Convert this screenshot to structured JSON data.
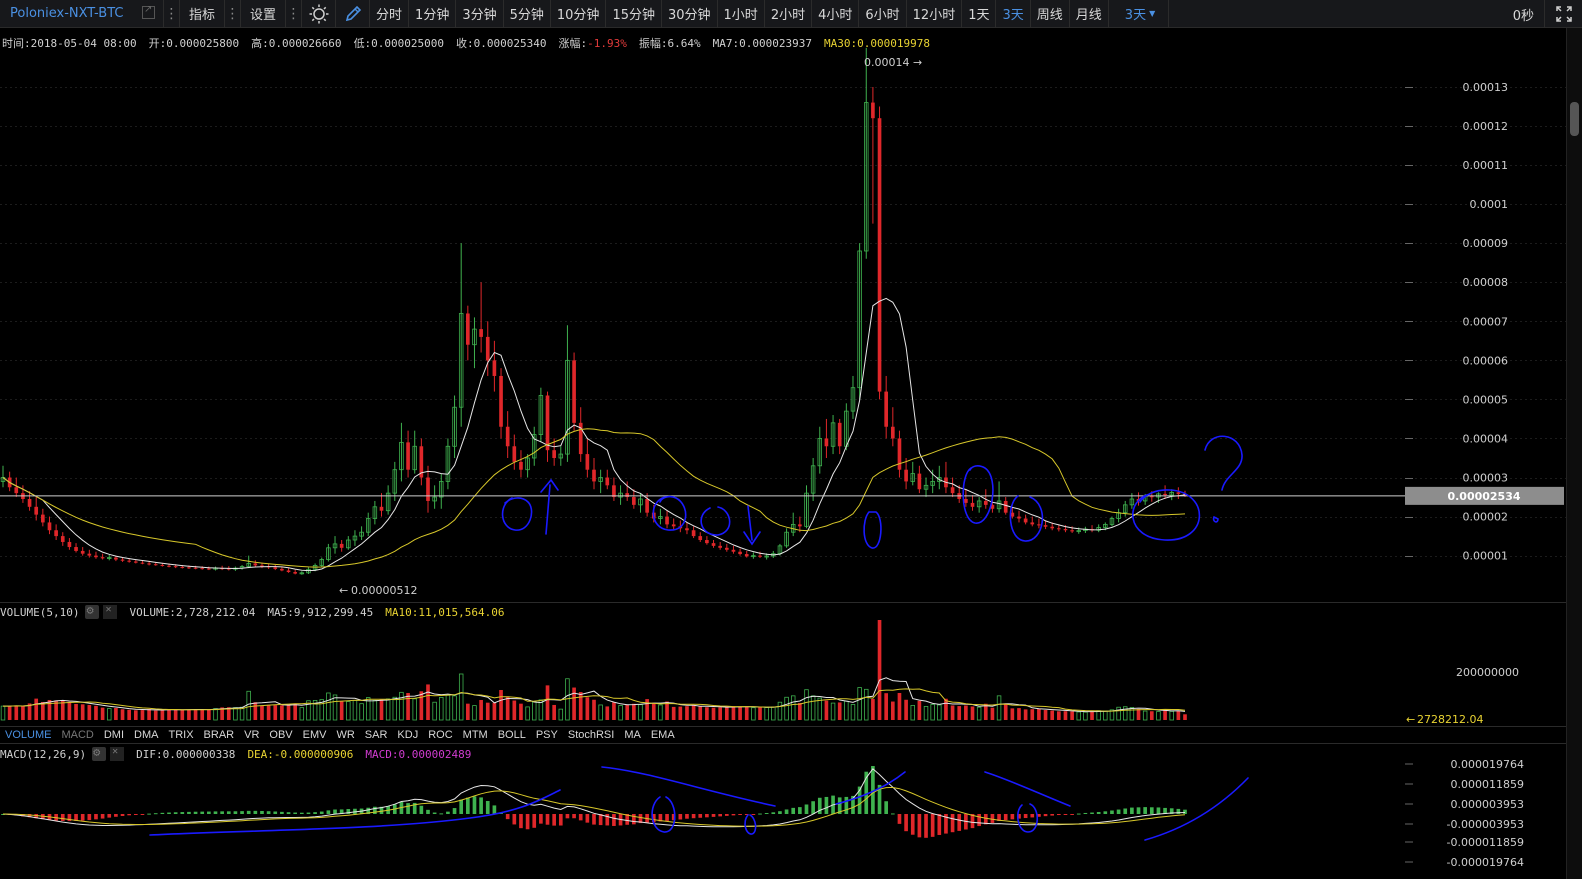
{
  "toolbar": {
    "symbol": "Poloniex-NXT-BTC",
    "indicator_label": "指标",
    "settings_label": "设置",
    "periods": [
      "分时",
      "1分钟",
      "3分钟",
      "5分钟",
      "10分钟",
      "15分钟",
      "30分钟",
      "1小时",
      "2小时",
      "4小时",
      "6小时",
      "12小时",
      "1天",
      "3天",
      "周线",
      "月线"
    ],
    "active_period": "3天",
    "selected_period": "3天",
    "countdown": "0秒"
  },
  "ohlc_info": {
    "time": "时间:2018-05-04 08:00",
    "open": "开:0.000025800",
    "high": "高:0.000026660",
    "low": "低:0.000025000",
    "close": "收:0.000025340",
    "change_label": "涨幅:",
    "change_value": "-1.93%",
    "amplitude": "振幅:6.64%",
    "ma7": "MA7:0.000023937",
    "ma30": "MA30:0.000019978"
  },
  "volume_info": {
    "title": "VOLUME(5,10)",
    "volume": "VOLUME:2,728,212.04",
    "ma5": "MA5:9,912,299.45",
    "ma10": "MA10:11,015,564.06"
  },
  "indicator_tabs": [
    "VOLUME",
    "MACD",
    "DMI",
    "DMA",
    "TRIX",
    "BRAR",
    "VR",
    "OBV",
    "EMV",
    "WR",
    "SAR",
    "KDJ",
    "ROC",
    "MTM",
    "BOLL",
    "PSY",
    "StochRSI",
    "MA",
    "EMA"
  ],
  "active_tab": "VOLUME",
  "dimmed_tab": "MACD",
  "macd_info": {
    "title": "MACD(12,26,9)",
    "dif": "DIF:0.000000338",
    "dea": "DEA:-0.000000906",
    "macd": "MACD:0.000002489"
  },
  "price_axis": {
    "ticks": [
      "0.00013",
      "0.00012",
      "0.00011",
      "0.0001",
      "0.00009",
      "0.00008",
      "0.00007",
      "0.00006",
      "0.00005",
      "0.00004",
      "0.00003",
      "0.00002",
      "0.00001"
    ],
    "current_price_label": "0.00002534",
    "max_marker": "0.00014",
    "min_marker": "0.00000512"
  },
  "volume_axis": {
    "ticks": [
      "200000000"
    ],
    "current_label": "2728212.04"
  },
  "macd_axis": {
    "ticks": [
      "0.000019764",
      "0.000011859",
      "0.000003953",
      "-0.000003953",
      "-0.000011859",
      "-0.000019764"
    ]
  },
  "colors": {
    "up": "#3fb24f",
    "down": "#e0272a",
    "ma7": "#e6e6e6",
    "ma30": "#d7c72a",
    "accent": "#4a90e2",
    "annotation": "#1a1aff"
  },
  "chart_data": {
    "type": "candlestick",
    "title": "Poloniex-NXT-BTC",
    "period": "3天",
    "price_range": [
      1.2e-06,
      0.0001369
    ],
    "series": [
      {
        "name": "MA7"
      },
      {
        "name": "MA30"
      }
    ],
    "candles": [
      [
        2.9e-05,
        3.3e-05,
        2.75e-05,
        3e-05
      ],
      [
        3e-05,
        3.15e-05,
        2.65e-05,
        2.75e-05
      ],
      [
        2.75e-05,
        3e-05,
        2.5e-05,
        2.6e-05
      ],
      [
        2.6e-05,
        2.8e-05,
        2.35e-05,
        2.45e-05
      ],
      [
        2.45e-05,
        2.65e-05,
        2.15e-05,
        2.25e-05
      ],
      [
        2.25e-05,
        2.5e-05,
        1.9e-05,
        2.05e-05
      ],
      [
        2.05e-05,
        2.2e-05,
        1.75e-05,
        1.85e-05
      ],
      [
        1.85e-05,
        2e-05,
        1.55e-05,
        1.65e-05
      ],
      [
        1.65e-05,
        1.8e-05,
        1.4e-05,
        1.5e-05
      ],
      [
        1.5e-05,
        1.6e-05,
        1.25e-05,
        1.35e-05
      ],
      [
        1.35e-05,
        1.45e-05,
        1.15e-05,
        1.22e-05
      ],
      [
        1.22e-05,
        1.32e-05,
        1.08e-05,
        1.12e-05
      ],
      [
        1.12e-05,
        1.22e-05,
        1e-05,
        1.05e-05
      ],
      [
        1.05e-05,
        1.15e-05,
        9.5e-06,
        1e-05
      ],
      [
        1e-05,
        1.1e-05,
        9.2e-06,
        9.6e-06
      ],
      [
        9.6e-06,
        1.05e-05,
        9e-06,
        9.3e-06
      ],
      [
        9.3e-06,
        1.02e-05,
        8.8e-06,
        9.5e-06
      ],
      [
        9.5e-06,
        1e-05,
        8.6e-06,
        9e-06
      ],
      [
        9e-06,
        9.6e-06,
        8.4e-06,
        8.7e-06
      ],
      [
        8.7e-06,
        9.3e-06,
        8.2e-06,
        8.5e-06
      ],
      [
        8.5e-06,
        9e-06,
        8e-06,
        8.2e-06
      ],
      [
        8.2e-06,
        8.8e-06,
        7.8e-06,
        8e-06
      ],
      [
        8e-06,
        8.6e-06,
        7.5e-06,
        7.8e-06
      ],
      [
        7.8e-06,
        8.3e-06,
        7.4e-06,
        7.6e-06
      ],
      [
        7.6e-06,
        8.1e-06,
        7.2e-06,
        7.4e-06
      ],
      [
        7.4e-06,
        8e-06,
        7e-06,
        7.3e-06
      ],
      [
        7.3e-06,
        7.8e-06,
        6.8e-06,
        7.1e-06
      ],
      [
        7.1e-06,
        7.6e-06,
        6.7e-06,
        7e-06
      ],
      [
        7e-06,
        7.5e-06,
        6.6e-06,
        6.9e-06
      ],
      [
        6.9e-06,
        7.4e-06,
        6.5e-06,
        6.8e-06
      ],
      [
        6.8e-06,
        7.3e-06,
        6.4e-06,
        6.7e-06
      ],
      [
        6.7e-06,
        7.2e-06,
        6.3e-06,
        6.6e-06
      ],
      [
        6.6e-06,
        7.2e-06,
        6.2e-06,
        6.8e-06
      ],
      [
        6.8e-06,
        7.4e-06,
        6.3e-06,
        6.7e-06
      ],
      [
        6.7e-06,
        7.3e-06,
        6.2e-06,
        6.6e-06
      ],
      [
        6.6e-06,
        7.2e-06,
        6.1e-06,
        6.8e-06
      ],
      [
        6.8e-06,
        7.6e-06,
        6.4e-06,
        7.2e-06
      ],
      [
        7.2e-06,
        1e-05,
        6.8e-06,
        8e-06
      ],
      [
        8e-06,
        8.8e-06,
        7e-06,
        7.5e-06
      ],
      [
        7.5e-06,
        8.2e-06,
        6.8e-06,
        7.3e-06
      ],
      [
        7.3e-06,
        8e-06,
        6.6e-06,
        7e-06
      ],
      [
        7e-06,
        7.6e-06,
        6.3e-06,
        6.6e-06
      ],
      [
        6.6e-06,
        7.2e-06,
        6e-06,
        6.2e-06
      ],
      [
        6.2e-06,
        6.8e-06,
        5.6e-06,
        5.8e-06
      ],
      [
        5.8e-06,
        6.4e-06,
        5.2e-06,
        5.4e-06
      ],
      [
        5.4e-06,
        6e-06,
        5.1e-06,
        5.6e-06
      ],
      [
        5.6e-06,
        7e-06,
        5.3e-06,
        6.5e-06
      ],
      [
        6.5e-06,
        8e-06,
        6e-06,
        7.5e-06
      ],
      [
        7.5e-06,
        9.5e-06,
        7e-06,
        9e-06
      ],
      [
        9e-06,
        1.3e-05,
        8.5e-06,
        1.2e-05
      ],
      [
        1.2e-05,
        1.5e-05,
        1.05e-05,
        1.3e-05
      ],
      [
        1.3e-05,
        1.4e-05,
        1.1e-05,
        1.2e-05
      ],
      [
        1.2e-05,
        1.5e-05,
        1.15e-05,
        1.4e-05
      ],
      [
        1.4e-05,
        1.65e-05,
        1.25e-05,
        1.5e-05
      ],
      [
        1.5e-05,
        1.75e-05,
        1.4e-05,
        1.6e-05
      ],
      [
        1.6e-05,
        2.1e-05,
        1.5e-05,
        1.95e-05
      ],
      [
        1.95e-05,
        2.4e-05,
        1.8e-05,
        2.25e-05
      ],
      [
        2.25e-05,
        2.6e-05,
        2e-05,
        2.15e-05
      ],
      [
        2.15e-05,
        2.8e-05,
        2.05e-05,
        2.6e-05
      ],
      [
        2.6e-05,
        3.4e-05,
        2.4e-05,
        3.2e-05
      ],
      [
        3.2e-05,
        4.4e-05,
        2.9e-05,
        3.9e-05
      ],
      [
        3.9e-05,
        4.2e-05,
        3e-05,
        3.2e-05
      ],
      [
        3.2e-05,
        4.2e-05,
        3.1e-05,
        3.8e-05
      ],
      [
        3.8e-05,
        4e-05,
        2.8e-05,
        3e-05
      ],
      [
        3e-05,
        3.3e-05,
        2.1e-05,
        2.4e-05
      ],
      [
        2.4e-05,
        2.8e-05,
        2.2e-05,
        2.5e-05
      ],
      [
        2.5e-05,
        3.1e-05,
        2.2e-05,
        2.9e-05
      ],
      [
        2.9e-05,
        4e-05,
        2.7e-05,
        3.8e-05
      ],
      [
        3.8e-05,
        5.1e-05,
        3.5e-05,
        4.8e-05
      ],
      [
        4.8e-05,
        9e-05,
        4.3e-05,
        7.2e-05
      ],
      [
        7.2e-05,
        7.4e-05,
        6e-05,
        6.4e-05
      ],
      [
        6.4e-05,
        7.1e-05,
        5.8e-05,
        6.8e-05
      ],
      [
        6.8e-05,
        8e-05,
        6.2e-05,
        6.6e-05
      ],
      [
        6.6e-05,
        7e-05,
        5.6e-05,
        6e-05
      ],
      [
        6e-05,
        6.5e-05,
        5.2e-05,
        5.6e-05
      ],
      [
        5.6e-05,
        5.8e-05,
        4e-05,
        4.3e-05
      ],
      [
        4.3e-05,
        4.7e-05,
        3.5e-05,
        3.8e-05
      ],
      [
        3.8e-05,
        4.1e-05,
        3.2e-05,
        3.4e-05
      ],
      [
        3.4e-05,
        3.7e-05,
        3e-05,
        3.2e-05
      ],
      [
        3.2e-05,
        3.6e-05,
        3e-05,
        3.5e-05
      ],
      [
        3.5e-05,
        4.3e-05,
        3.3e-05,
        4.1e-05
      ],
      [
        4.1e-05,
        5.3e-05,
        3.9e-05,
        5.1e-05
      ],
      [
        5.1e-05,
        5.2e-05,
        3.4e-05,
        3.7e-05
      ],
      [
        3.7e-05,
        4e-05,
        3.3e-05,
        3.5e-05
      ],
      [
        3.5e-05,
        3.8e-05,
        3.3e-05,
        3.6e-05
      ],
      [
        3.6e-05,
        6.9e-05,
        3.4e-05,
        6e-05
      ],
      [
        6e-05,
        6.2e-05,
        4.2e-05,
        4.4e-05
      ],
      [
        4.4e-05,
        4.8e-05,
        3.4e-05,
        3.6e-05
      ],
      [
        3.6e-05,
        4e-05,
        3e-05,
        3.2e-05
      ],
      [
        3.2e-05,
        3.5e-05,
        2.7e-05,
        2.9e-05
      ],
      [
        2.9e-05,
        3.2e-05,
        2.6e-05,
        3e-05
      ],
      [
        3e-05,
        3.2e-05,
        2.7e-05,
        2.8e-05
      ],
      [
        2.8e-05,
        3e-05,
        2.4e-05,
        2.5e-05
      ],
      [
        2.5e-05,
        2.8e-05,
        2.3e-05,
        2.6e-05
      ],
      [
        2.6e-05,
        2.9e-05,
        2.4e-05,
        2.5e-05
      ],
      [
        2.5e-05,
        2.7e-05,
        2.2e-05,
        2.3e-05
      ],
      [
        2.3e-05,
        2.6e-05,
        2.1e-05,
        2.45e-05
      ],
      [
        2.45e-05,
        2.6e-05,
        2e-05,
        2.1e-05
      ],
      [
        2.1e-05,
        2.3e-05,
        1.85e-05,
        1.95e-05
      ],
      [
        1.95e-05,
        2.2e-05,
        1.8e-05,
        2e-05
      ],
      [
        2e-05,
        2.15e-05,
        1.7e-05,
        1.8e-05
      ],
      [
        1.8e-05,
        1.95e-05,
        1.65e-05,
        1.75e-05
      ],
      [
        1.75e-05,
        1.9e-05,
        1.6e-05,
        1.7e-05
      ],
      [
        1.7e-05,
        1.85e-05,
        1.55e-05,
        1.65e-05
      ],
      [
        1.65e-05,
        1.75e-05,
        1.45e-05,
        1.5e-05
      ],
      [
        1.5e-05,
        1.6e-05,
        1.35e-05,
        1.4e-05
      ],
      [
        1.4e-05,
        1.5e-05,
        1.28e-05,
        1.32e-05
      ],
      [
        1.32e-05,
        1.4e-05,
        1.2e-05,
        1.25e-05
      ],
      [
        1.25e-05,
        1.35e-05,
        1.15e-05,
        1.2e-05
      ],
      [
        1.2e-05,
        1.3e-05,
        1.1e-05,
        1.15e-05
      ],
      [
        1.15e-05,
        1.25e-05,
        1.05e-05,
        1.1e-05
      ],
      [
        1.1e-05,
        1.18e-05,
        1e-05,
        1.04e-05
      ],
      [
        1.04e-05,
        1.12e-05,
        9.5e-06,
        9.8e-06
      ],
      [
        9.8e-06,
        1.08e-05,
        9.2e-06,
        1e-05
      ],
      [
        1e-05,
        1.1e-05,
        9.4e-06,
        9.7e-06
      ],
      [
        9.7e-06,
        1.06e-05,
        9e-06,
        9.9e-06
      ],
      [
        9.9e-06,
        1.12e-05,
        9.4e-06,
        1.05e-05
      ],
      [
        1.05e-05,
        1.3e-05,
        1e-05,
        1.25e-05
      ],
      [
        1.25e-05,
        1.7e-05,
        1.2e-05,
        1.6e-05
      ],
      [
        1.6e-05,
        2.1e-05,
        1.5e-05,
        1.8e-05
      ],
      [
        1.8e-05,
        2e-05,
        1.6e-05,
        1.75e-05
      ],
      [
        1.75e-05,
        2.8e-05,
        1.7e-05,
        2.6e-05
      ],
      [
        2.6e-05,
        3.5e-05,
        2.4e-05,
        3.3e-05
      ],
      [
        3.3e-05,
        4.3e-05,
        3.1e-05,
        4e-05
      ],
      [
        4e-05,
        4.5e-05,
        3.5e-05,
        3.8e-05
      ],
      [
        3.8e-05,
        4.6e-05,
        3.6e-05,
        4.4e-05
      ],
      [
        4.4e-05,
        4.5e-05,
        3.6e-05,
        3.8e-05
      ],
      [
        3.8e-05,
        4.9e-05,
        3.7e-05,
        4.7e-05
      ],
      [
        4.7e-05,
        5.6e-05,
        4.5e-05,
        5.3e-05
      ],
      [
        5.3e-05,
        9e-05,
        5e-05,
        8.8e-05
      ],
      [
        8.8e-05,
        0.00014,
        8.6e-05,
        0.000126
      ],
      [
        0.000126,
        0.00013,
        9.5e-05,
        0.000122
      ],
      [
        0.000122,
        0.000125,
        5e-05,
        5.2e-05
      ],
      [
        5.2e-05,
        5.6e-05,
        4e-05,
        4.3e-05
      ],
      [
        4.3e-05,
        4.8e-05,
        3.8e-05,
        4e-05
      ],
      [
        4e-05,
        4.2e-05,
        3e-05,
        3.2e-05
      ],
      [
        3.2e-05,
        3.5e-05,
        2.7e-05,
        2.9e-05
      ],
      [
        2.9e-05,
        3.4e-05,
        2.8e-05,
        3.1e-05
      ],
      [
        3.1e-05,
        3.3e-05,
        2.6e-05,
        2.7e-05
      ],
      [
        2.7e-05,
        3e-05,
        2.5e-05,
        2.8e-05
      ],
      [
        2.8e-05,
        3.2e-05,
        2.6e-05,
        2.9e-05
      ],
      [
        2.9e-05,
        3.3e-05,
        2.7e-05,
        3e-05
      ],
      [
        3e-05,
        3.4e-05,
        2.6e-05,
        2.75e-05
      ],
      [
        2.75e-05,
        3e-05,
        2.5e-05,
        2.6e-05
      ],
      [
        2.6e-05,
        2.8e-05,
        2.35e-05,
        2.45e-05
      ],
      [
        2.45e-05,
        2.7e-05,
        2.25e-05,
        2.35e-05
      ],
      [
        2.35e-05,
        2.55e-05,
        2.15e-05,
        2.25e-05
      ],
      [
        2.25e-05,
        2.5e-05,
        2.1e-05,
        2.4e-05
      ],
      [
        2.4e-05,
        2.7e-05,
        2.2e-05,
        2.3e-05
      ],
      [
        2.3e-05,
        2.45e-05,
        2.1e-05,
        2.2e-05
      ],
      [
        2.2e-05,
        2.9e-05,
        2.1e-05,
        2.4e-05
      ],
      [
        2.4e-05,
        2.5e-05,
        2.05e-05,
        2.1e-05
      ],
      [
        2.1e-05,
        2.25e-05,
        1.95e-05,
        2e-05
      ],
      [
        2e-05,
        2.15e-05,
        1.85e-05,
        1.95e-05
      ],
      [
        1.95e-05,
        2.05e-05,
        1.8e-05,
        1.85e-05
      ],
      [
        1.85e-05,
        2e-05,
        1.75e-05,
        1.8e-05
      ],
      [
        1.8e-05,
        1.95e-05,
        1.7e-05,
        1.78e-05
      ],
      [
        1.78e-05,
        1.9e-05,
        1.68e-05,
        1.74e-05
      ],
      [
        1.74e-05,
        1.85e-05,
        1.65e-05,
        1.7e-05
      ],
      [
        1.7e-05,
        1.8e-05,
        1.62e-05,
        1.68e-05
      ],
      [
        1.68e-05,
        1.78e-05,
        1.6e-05,
        1.65e-05
      ],
      [
        1.65e-05,
        1.75e-05,
        1.58e-05,
        1.62e-05
      ],
      [
        1.62e-05,
        1.72e-05,
        1.56e-05,
        1.64e-05
      ],
      [
        1.64e-05,
        1.74e-05,
        1.58e-05,
        1.68e-05
      ],
      [
        1.68e-05,
        1.78e-05,
        1.6e-05,
        1.65e-05
      ],
      [
        1.65e-05,
        1.8e-05,
        1.6e-05,
        1.72e-05
      ],
      [
        1.72e-05,
        1.85e-05,
        1.65e-05,
        1.8e-05
      ],
      [
        1.8e-05,
        2e-05,
        1.75e-05,
        1.95e-05
      ],
      [
        1.95e-05,
        2.2e-05,
        1.85e-05,
        2.1e-05
      ],
      [
        2.1e-05,
        2.4e-05,
        2e-05,
        2.3e-05
      ],
      [
        2.3e-05,
        2.6e-05,
        2.2e-05,
        2.45e-05
      ],
      [
        2.45e-05,
        2.62e-05,
        2.28e-05,
        2.4e-05
      ],
      [
        2.4e-05,
        2.58e-05,
        2.3e-05,
        2.52e-05
      ],
      [
        2.52e-05,
        2.65e-05,
        2.38e-05,
        2.5e-05
      ],
      [
        2.5e-05,
        2.62e-05,
        2.35e-05,
        2.58e-05
      ],
      [
        2.58e-05,
        2.8e-05,
        2.45e-05,
        2.55e-05
      ],
      [
        2.55e-05,
        2.7e-05,
        2.42e-05,
        2.62e-05
      ],
      [
        2.62e-05,
        2.75e-05,
        2.45e-05,
        2.58e-05
      ],
      [
        2.58e-05,
        2.66e-05,
        2.5e-05,
        2.53e-05
      ]
    ],
    "volume_scale": {
      "tick": 200000000
    }
  }
}
